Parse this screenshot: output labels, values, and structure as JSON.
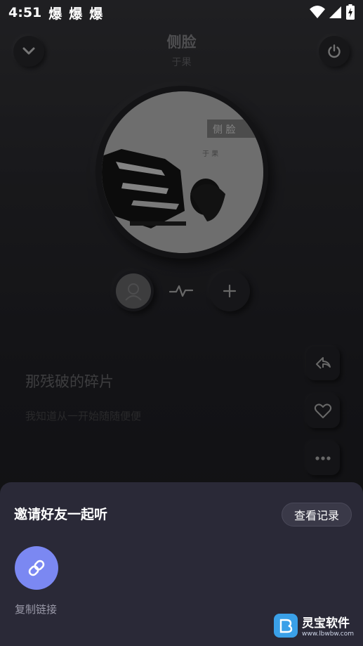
{
  "status_bar": {
    "time": "4:51",
    "notifications": [
      "爆",
      "爆",
      "爆"
    ]
  },
  "header": {
    "title": "侧脸",
    "artist": "于果",
    "collapse_icon": "chevron-down-icon",
    "power_icon": "power-icon"
  },
  "cover": {
    "text_1": "侧 脸",
    "text_2": "于 果"
  },
  "lyrics": {
    "current": "那残破的碎片",
    "next": "我知道从一开始随随便便"
  },
  "share_sheet": {
    "title": "邀请好友一起听",
    "history_label": "查看记录",
    "copy_link_label": "复制链接"
  },
  "watermark": {
    "name": "灵宝软件",
    "url": "www.lbwbw.com"
  },
  "colors": {
    "accent": "#7b88f2",
    "sheet_bg": "#2a2937"
  }
}
